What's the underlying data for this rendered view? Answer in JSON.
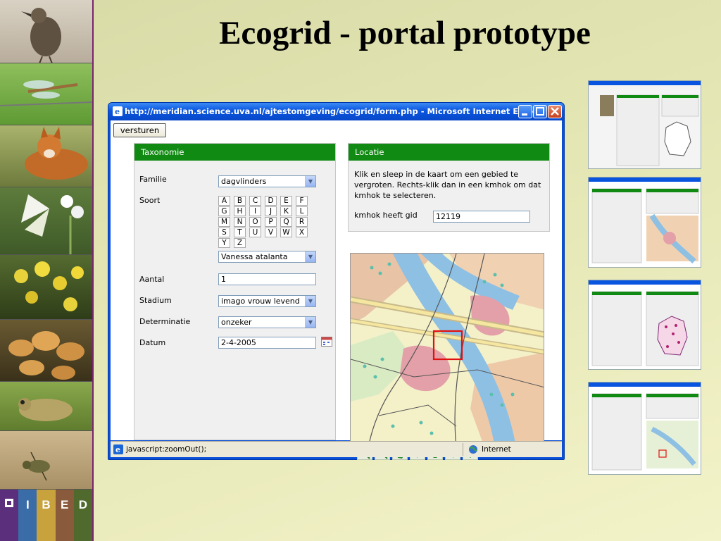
{
  "slide": {
    "title": "Ecogrid - portal prototype",
    "brand_letters": [
      "I",
      "B",
      "E",
      "D"
    ],
    "accent_color": "#7a2470"
  },
  "browser": {
    "title": "http://meridian.science.uva.nl/ajtestomgeving/ecogrid/form.php - Microsoft Internet Explorer",
    "status_text": "javascript:zoomOut();",
    "zone_text": "Internet"
  },
  "form": {
    "submit_label": "versturen",
    "taxonomy_panel": {
      "heading": "Taxonomie",
      "familie_label": "Familie",
      "familie_value": "dagvlinders",
      "soort_label": "Soort",
      "letters": [
        "A",
        "B",
        "C",
        "D",
        "E",
        "F",
        "G",
        "H",
        "I",
        "J",
        "K",
        "L",
        "M",
        "N",
        "O",
        "P",
        "Q",
        "R",
        "S",
        "T",
        "U",
        "V",
        "W",
        "X",
        "Y",
        "Z"
      ],
      "soort_value": "Vanessa atalanta",
      "aantal_label": "Aantal",
      "aantal_value": "1",
      "stadium_label": "Stadium",
      "stadium_value": "imago vrouw levend",
      "determinatie_label": "Determinatie",
      "determinatie_value": "onzeker",
      "datum_label": "Datum",
      "datum_value": "2-4-2005"
    },
    "location_panel": {
      "heading": "Locatie",
      "instructions": "Klik en sleep in de kaart om een gebied te vergroten. Rechts-klik dan in een kmhok om dat kmhok te selecteren.",
      "kmhok_label": "kmhok heeft gid",
      "kmhok_value": "12119"
    },
    "map_tools": [
      "zoom-in-icon",
      "zoom-out-icon",
      "full-extent-icon",
      "arrow-left-icon",
      "arrow-up-icon",
      "arrow-right-icon",
      "arrow-down-icon"
    ]
  },
  "colors": {
    "panel_header_green": "#118a13",
    "xp_title_blue": "#0a55df"
  }
}
